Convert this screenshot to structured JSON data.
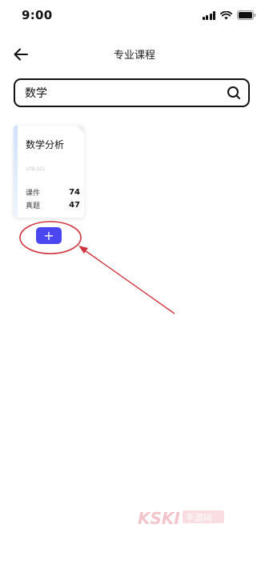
{
  "status_bar": {
    "time": "9:00"
  },
  "nav": {
    "title": "专业课程"
  },
  "search": {
    "value": "数学"
  },
  "course_card": {
    "title": "数学分析",
    "subtitle": "108,021",
    "stats": [
      {
        "label": "课件",
        "value": "74"
      },
      {
        "label": "真题",
        "value": "47"
      }
    ]
  },
  "add_button": {
    "label": "+"
  },
  "watermark": {
    "text": "KSKI手游网"
  },
  "colors": {
    "accent": "#4a46f0",
    "annotation": "#d0363f",
    "text": "#111111"
  }
}
